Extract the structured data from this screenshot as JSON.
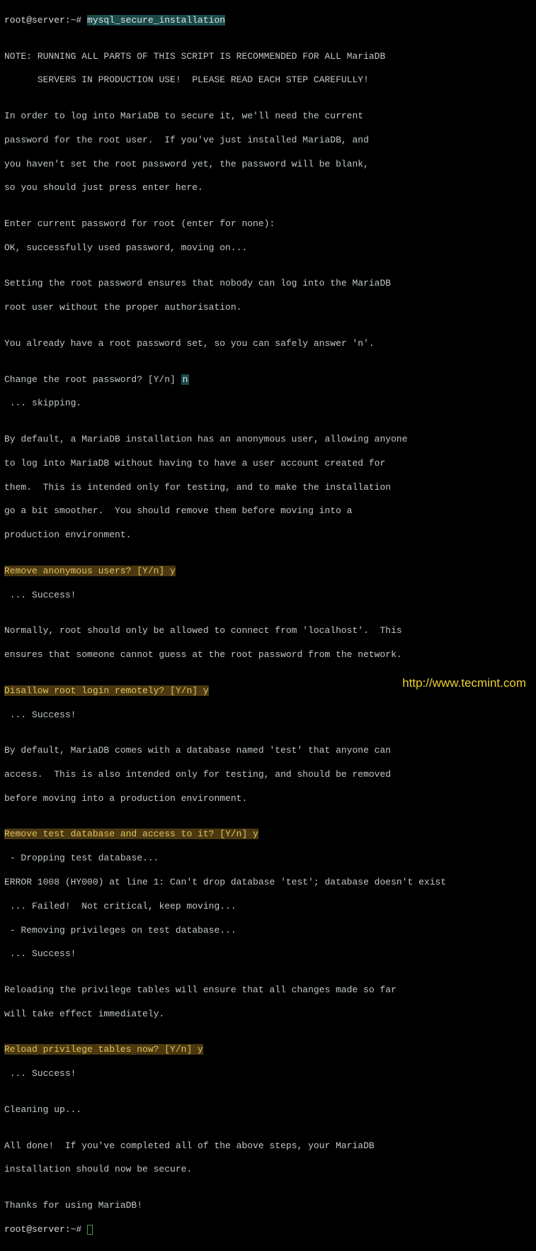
{
  "prompt1": "root@server:~# ",
  "command": "mysql_secure_installation",
  "blank": "",
  "note1": "NOTE: RUNNING ALL PARTS OF THIS SCRIPT IS RECOMMENDED FOR ALL MariaDB",
  "note2": "      SERVERS IN PRODUCTION USE!  PLEASE READ EACH STEP CAREFULLY!",
  "intro1": "In order to log into MariaDB to secure it, we'll need the current",
  "intro2": "password for the root user.  If you've just installed MariaDB, and",
  "intro3": "you haven't set the root password yet, the password will be blank,",
  "intro4": "so you should just press enter here.",
  "enterpw": "Enter current password for root (enter for none):",
  "ok1": "OK, successfully used password, moving on...",
  "set1": "Setting the root password ensures that nobody can log into the MariaDB",
  "set2": "root user without the proper authorisation.",
  "already": "You already have a root password set, so you can safely answer 'n'.",
  "q1": "Change the root password? [Y/n] ",
  "a1": "n",
  "skip": " ... skipping.",
  "anon1": "By default, a MariaDB installation has an anonymous user, allowing anyone",
  "anon2": "to log into MariaDB without having to have a user account created for",
  "anon3": "them.  This is intended only for testing, and to make the installation",
  "anon4": "go a bit smoother.  You should remove them before moving into a",
  "anon5": "production environment.",
  "q2": "Remove anonymous users? [Y/n] y",
  "success": " ... Success!",
  "norm1": "Normally, root should only be allowed to connect from 'localhost'.  This",
  "norm2": "ensures that someone cannot guess at the root password from the network.",
  "q3": "Disallow root login remotely? [Y/n] y",
  "test1": "By default, MariaDB comes with a database named 'test' that anyone can",
  "test2": "access.  This is also intended only for testing, and should be removed",
  "test3": "before moving into a production environment.",
  "q4": "Remove test database and access to it? [Y/n] y",
  "drop1": " - Dropping test database...",
  "err1": "ERROR 1008 (HY000) at line 1: Can't drop database 'test'; database doesn't exist",
  "fail1": " ... Failed!  Not critical, keep moving...",
  "remov": " - Removing privileges on test database...",
  "reload1": "Reloading the privilege tables will ensure that all changes made so far",
  "reload2": "will take effect immediately.",
  "q5": "Reload privilege tables now? [Y/n] y",
  "clean": "Cleaning up...",
  "done1": "All done!  If you've completed all of the above steps, your MariaDB",
  "done2": "installation should now be secure.",
  "thanks": "Thanks for using MariaDB!",
  "watermark": "http://www.tecmint.com"
}
